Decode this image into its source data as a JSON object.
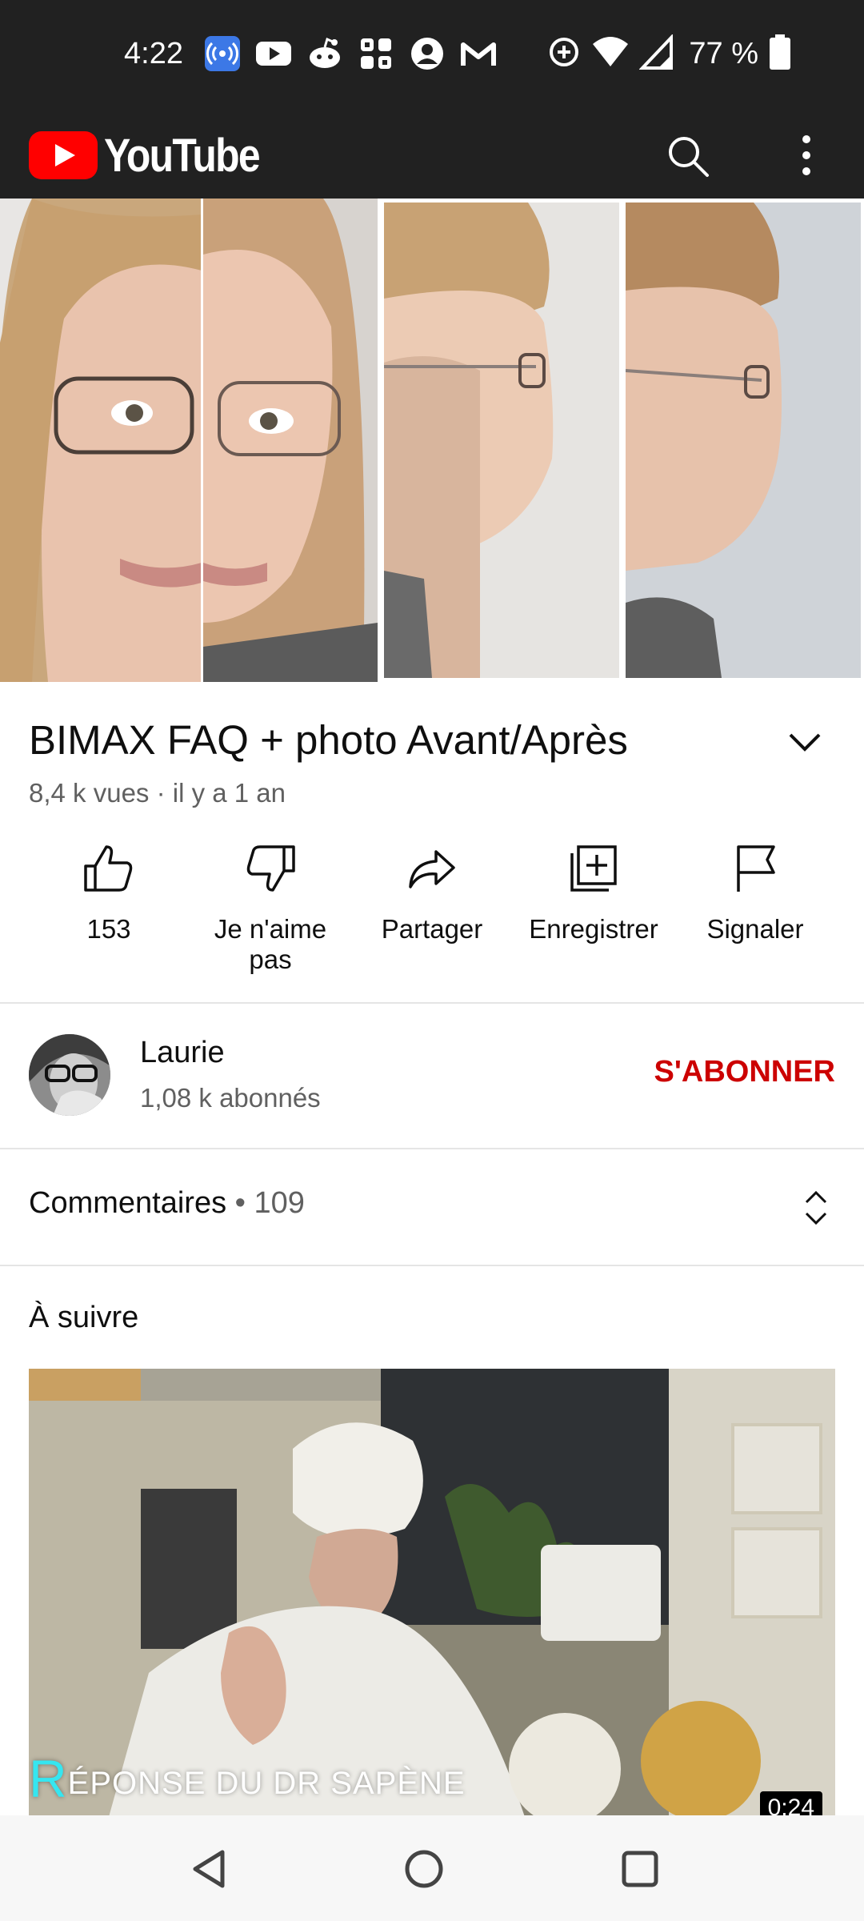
{
  "status_bar": {
    "time": "4:22",
    "battery": "77 %",
    "icons": [
      "broadcast-icon",
      "youtube-icon",
      "reddit-icon",
      "grid-app-icon",
      "account-icon",
      "gmail-icon",
      "data-saver-icon",
      "wifi-icon",
      "signal-icon",
      "battery-icon"
    ]
  },
  "app_bar": {
    "logo_text": "YouTube",
    "actions": [
      "search-icon",
      "more-vert-icon"
    ],
    "brand_red": "#FF0000",
    "background": "#212121"
  },
  "video": {
    "title": "BIMAX FAQ + photo Avant/Après",
    "meta": "8,4 k vues · il y a 1 an"
  },
  "actions": [
    {
      "icon": "thumb-up-icon",
      "label": "153"
    },
    {
      "icon": "thumb-down-icon",
      "label": "Je n'aime pas"
    },
    {
      "icon": "share-icon",
      "label": "Partager"
    },
    {
      "icon": "add-to-playlist-icon",
      "label": "Enregistrer"
    },
    {
      "icon": "flag-icon",
      "label": "Signaler"
    }
  ],
  "channel": {
    "name": "Laurie",
    "subscribers": "1,08 k abonnés",
    "subscribe_label": "S'ABONNER",
    "subscribe_color": "#CC0000"
  },
  "comments": {
    "label": "Commentaires",
    "count": "• 109"
  },
  "up_next": {
    "label": "À suivre",
    "caption_first": "R",
    "caption_rest": "ÉPONSE DU DR SAPÈNE",
    "duration": "0:24"
  },
  "nav_bar": [
    "back-icon",
    "home-icon",
    "recents-icon"
  ]
}
